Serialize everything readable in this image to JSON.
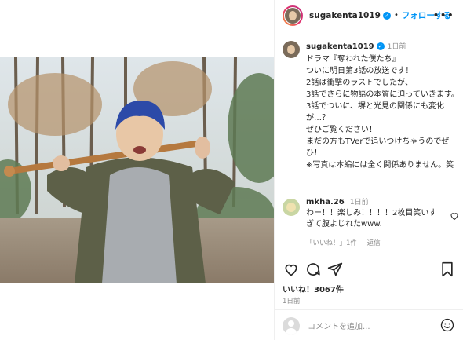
{
  "post": {
    "username": "sugakenta1019",
    "follow_label": "フォローする",
    "more_label": "•••",
    "dot": "•"
  },
  "caption": {
    "username": "sugakenta1019",
    "time": "1日前",
    "lines": [
      "ドラマ『奪われた僕たち』",
      "ついに明日第3話の放送です！",
      "2話は衝撃のラストでしたが、",
      "3話でさらに物語の本質に迫っていきます。",
      "3話でついに、堺と光見の関係にも変化が…？",
      "ぜひご覧ください！",
      "まだの方もTVerで追いつけちゃうのでぜひ！",
      "",
      "※写真は本編には全く関係ありません。笑"
    ]
  },
  "comment": {
    "username": "mkha.26",
    "time": "1日前",
    "text": "わー！！楽しみ！！！！2枚目笑いすぎて腹よじれたwww.",
    "likes_label": "「いいね！」1件",
    "reply_label": "返信"
  },
  "actions": {
    "likes": "いいね！3067件",
    "ago": "1日前",
    "comment_placeholder": "コメントを追加..."
  },
  "colors": {
    "accent": "#0095f6",
    "text": "#262626",
    "muted": "#8e8e8e",
    "border": "#efefef"
  },
  "icons": [
    "heart-icon",
    "comment-icon",
    "share-icon",
    "bookmark-icon",
    "emoji-icon",
    "verified-icon",
    "more-icon"
  ]
}
